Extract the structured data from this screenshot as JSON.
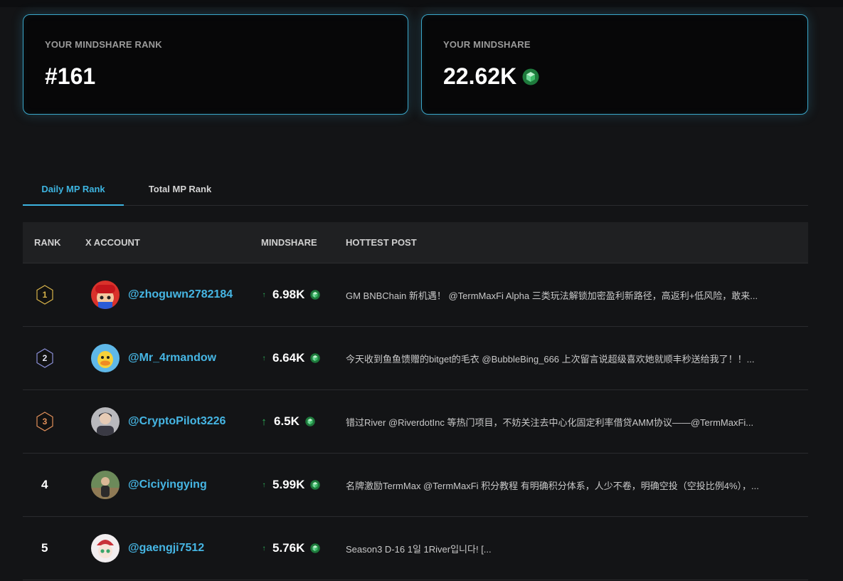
{
  "stats": {
    "rank_label": "YOUR MINDSHARE RANK",
    "rank_value": "#161",
    "mindshare_label": "YOUR MINDSHARE",
    "mindshare_value": "22.62K"
  },
  "tabs": [
    {
      "label": "Daily MP Rank",
      "active": true
    },
    {
      "label": "Total MP Rank",
      "active": false
    }
  ],
  "table": {
    "headers": {
      "rank": "RANK",
      "account": "X ACCOUNT",
      "mindshare": "MINDSHARE",
      "post": "HOTTEST POST"
    },
    "rows": [
      {
        "rank": "1",
        "handle": "@zhoguwn2782184",
        "mindshare": "6.98K",
        "trend": "↑",
        "post": "GM BNBChain 新机遇！ @TermMaxFi Alpha 三类玩法解锁加密盈利新路径，高返利+低风险，敢来..."
      },
      {
        "rank": "2",
        "handle": "@Mr_4rmandow",
        "mindshare": "6.64K",
        "trend": "↑",
        "post": "今天收到鱼鱼馈赠的bitget的毛衣 @BubbleBing_666 上次留言说超级喜欢她就顺丰秒送给我了！！..."
      },
      {
        "rank": "3",
        "handle": "@CryptoPilot3226",
        "mindshare": "6.5K",
        "trend": "↑",
        "post": "错过River @RiverdotInc 等热门项目，不妨关注去中心化固定利率借贷AMM协议——@TermMaxFi..."
      },
      {
        "rank": "4",
        "handle": "@Ciciyingying",
        "mindshare": "5.99K",
        "trend": "↑",
        "post": "名牌激励TermMax @TermMaxFi 积分教程 有明确积分体系，人少不卷，明确空投（空投比例4%），..."
      },
      {
        "rank": "5",
        "handle": "@gaengji7512",
        "mindshare": "5.76K",
        "trend": "↑",
        "post": "Season3 D-16 1일 1River입니다! [..."
      }
    ]
  },
  "colors": {
    "accent": "#3db4e0",
    "gem": "#2fb35a",
    "rank1": "#d6b24a",
    "rank2": "#8a8fd6",
    "rank3": "#e08f5a"
  },
  "icons": {
    "gem": "green-cube-icon",
    "trend": "up-arrow-icon"
  }
}
